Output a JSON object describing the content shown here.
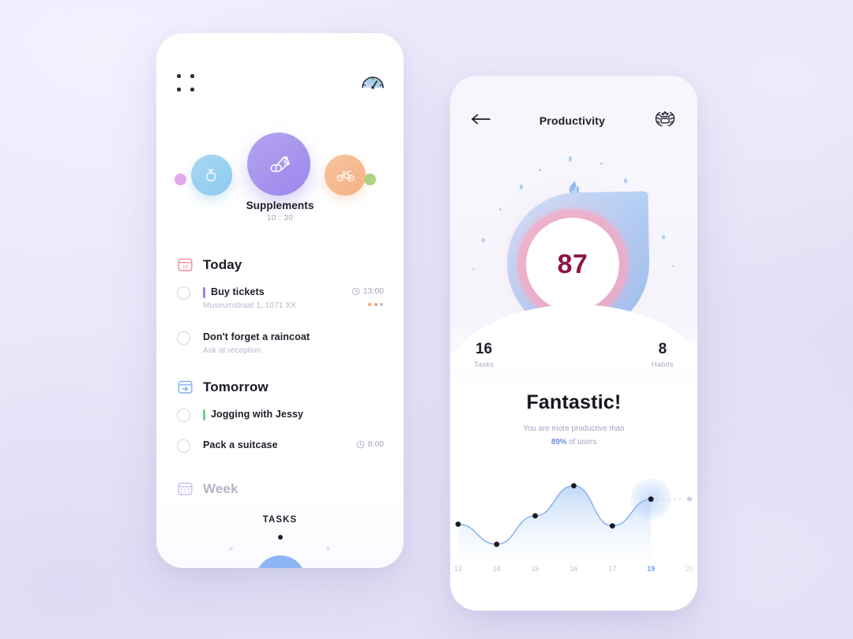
{
  "background": {
    "gradient_from": "#eeeafd",
    "gradient_to": "#dcdaf2"
  },
  "left_screen": {
    "topbar": {
      "menu_icon": "grid-dots-icon",
      "gauge_icon": "speedometer-icon"
    },
    "habits": {
      "items": [
        {
          "icon": "fruit-icon",
          "color": "#8ecaf0",
          "name": "fruit-habit"
        },
        {
          "icon": "pill-leaf-icon",
          "color": "#9b87ec",
          "name": "supplements-habit"
        },
        {
          "icon": "bicycle-icon",
          "color": "#f5b186",
          "name": "cycling-habit"
        }
      ],
      "side_dot_left_color": "#e6a8ea",
      "side_dot_right_color": "#aed184",
      "selected_name": "Supplements",
      "selected_time": "10 : 30"
    },
    "sections": [
      {
        "title": "Today",
        "icon": "calendar-today-icon",
        "icon_color": "#f58aa0",
        "muted": false,
        "tasks": [
          {
            "title": "Buy tickets",
            "subtitle": "Museumstraat 1, 1071 XX",
            "time": "13:00",
            "accent": "#9b87ec",
            "has_more": true,
            "more_dots": [
              "#f0a070",
              "#f0a070",
              "#c3c5d8"
            ],
            "checked": false
          },
          {
            "title": "Don't forget a raincoat",
            "subtitle": "Ask at reception",
            "time": "",
            "accent": "",
            "has_more": false,
            "more_dots": [],
            "checked": false
          }
        ]
      },
      {
        "title": "Tomorrow",
        "icon": "arrow-in-box-icon",
        "icon_color": "#7fb0f0",
        "muted": false,
        "tasks": [
          {
            "title": "Jogging with Jessy",
            "subtitle": "",
            "time": "",
            "accent": "#6fd18f",
            "has_more": false,
            "more_dots": [],
            "checked": false
          },
          {
            "title": "Pack a suitcase",
            "subtitle": "",
            "time": "8:00",
            "accent": "",
            "has_more": false,
            "more_dots": [],
            "checked": false
          }
        ]
      },
      {
        "title": "Week",
        "icon": "calendar-grid-icon",
        "icon_color": "#c3b5ef",
        "muted": true,
        "tasks": []
      }
    ],
    "footer": {
      "tab_label": "TASKS",
      "add_button_icon": "plus-icon",
      "add_button_color": "#82acf2"
    }
  },
  "right_screen": {
    "header": {
      "back_icon": "arrow-left-icon",
      "title": "Productivity",
      "award_icon": "laurel-wreath-icon"
    },
    "hero": {
      "flame_icon": "flame-icon",
      "score": "87",
      "score_color": "#8d1446",
      "ring_color": "#faa5be",
      "leaf_color": "#a9c8f3"
    },
    "stats": [
      {
        "value": "16",
        "label": "Tasks"
      },
      {
        "value": "8",
        "label": "Habits"
      }
    ],
    "verdict": "Fantastic!",
    "subtitle_line1": "You are more productive than",
    "subtitle_percent": "89%",
    "subtitle_line2_rest": " of users"
  },
  "chart_data": {
    "type": "line",
    "title": "",
    "xlabel": "",
    "ylabel": "",
    "grid": false,
    "legend": "none",
    "categories": [
      "13",
      "14",
      "15",
      "16",
      "17",
      "19",
      "20"
    ],
    "x": [
      13,
      14,
      15,
      16,
      17,
      19,
      20
    ],
    "values": [
      42,
      18,
      52,
      88,
      40,
      72,
      72
    ],
    "ylim": [
      0,
      100
    ],
    "highlight_index": 5,
    "highlight_label": "19",
    "projected_index": 6,
    "projected_style": "dotted",
    "line_color": "#8fb4ee",
    "point_color": "#1a1a24",
    "fill_gradient_from": "#bed6f7",
    "fill_gradient_to": "#eef4fd",
    "annotations": []
  }
}
